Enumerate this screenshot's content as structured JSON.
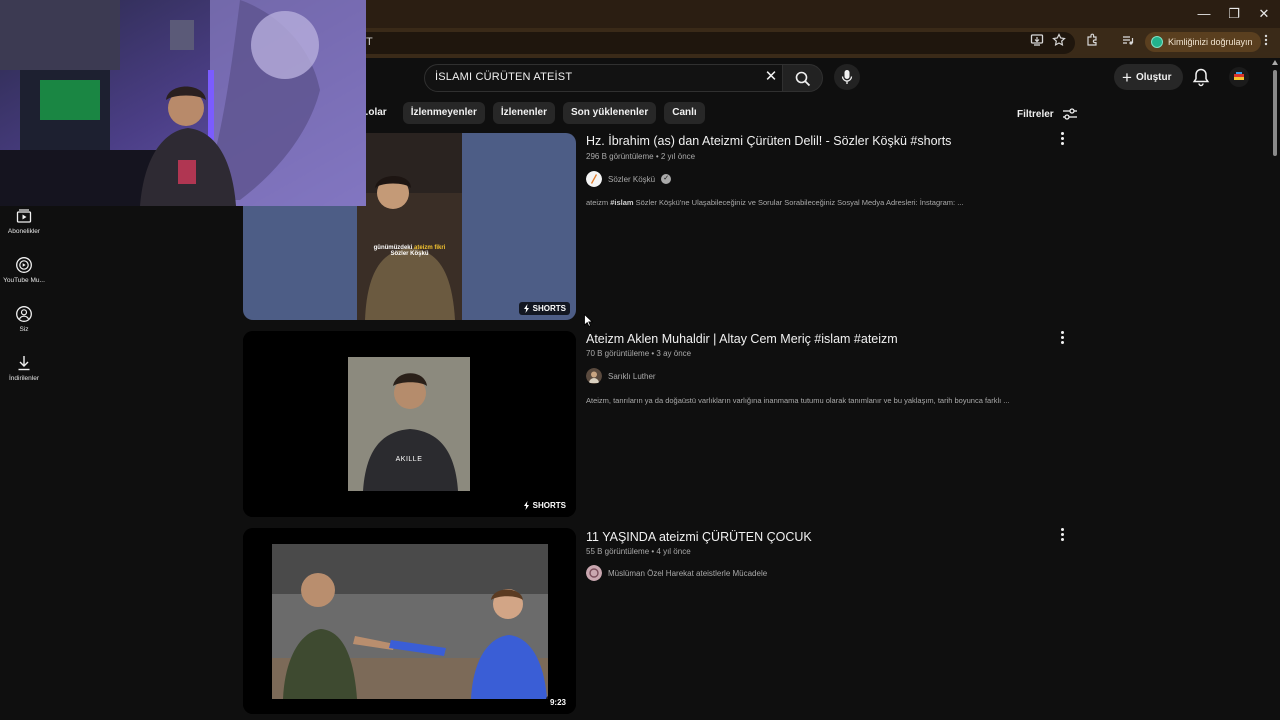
{
  "browser": {
    "url_fragment": "T",
    "verify_label": "Kimliğinizi doğrulayın",
    "window_controls": {
      "minimize": "—",
      "restore": "❐",
      "close": "✕"
    }
  },
  "youtube": {
    "search": {
      "query": "İSLAMI CÜRÜTEN  ATEİST"
    },
    "create_label": "Oluştur",
    "chips": [
      "...olar",
      "İzlenmeyenler",
      "İzlenenler",
      "Son yüklenenler",
      "Canlı"
    ],
    "filters_label": "Filtreler",
    "sidebar": [
      {
        "label": "Abonelikler",
        "icon": "subscriptions-icon"
      },
      {
        "label": "YouTube Mu...",
        "icon": "youtube-music-icon"
      },
      {
        "label": "Siz",
        "icon": "you-icon"
      },
      {
        "label": "İndirilenler",
        "icon": "downloads-icon"
      }
    ],
    "results": [
      {
        "title": "Hz. İbrahim (as) dan Ateizmi Çürüten Delil! - Sözler Köşkü #shorts",
        "meta": "296 B görüntüleme • 2 yıl önce",
        "channel": "Sözler Köşkü",
        "verified": true,
        "desc_pre": "ateizm ",
        "desc_bold": "#islam",
        "desc_post": " Sözler Köşkü'ne Ulaşabileceğiniz ve Sorular Sorabileceğiniz Sosyal Medya Adresleri: İnstagram: ...",
        "badge": "SHORTS",
        "thumb_caption_1": "günümüzdeki",
        "thumb_caption_hl": "ateizm fikri",
        "thumb_caption_2": "Sözler Köşkü"
      },
      {
        "title": "Ateizm Aklen Muhaldir | Altay Cem Meriç #islam #ateizm",
        "meta": "70 B görüntüleme • 3 ay önce",
        "channel": "Sarıklı Luther",
        "verified": false,
        "desc": "Ateizm, tanrıların ya da doğaüstü varlıkların varlığına inanmama tutumu olarak tanımlanır ve bu yaklaşım, tarih boyunca farklı ...",
        "badge": "SHORTS",
        "thumb_caption": "AKILLE"
      },
      {
        "title": "11 YAŞINDA ateizmi ÇÜRÜTEN ÇOCUK",
        "meta": "55 B görüntüleme • 4 yıl önce",
        "channel": "Müslüman Özel Harekat ateistlerle Mücadele",
        "verified": false,
        "badge": "9:23"
      }
    ]
  }
}
